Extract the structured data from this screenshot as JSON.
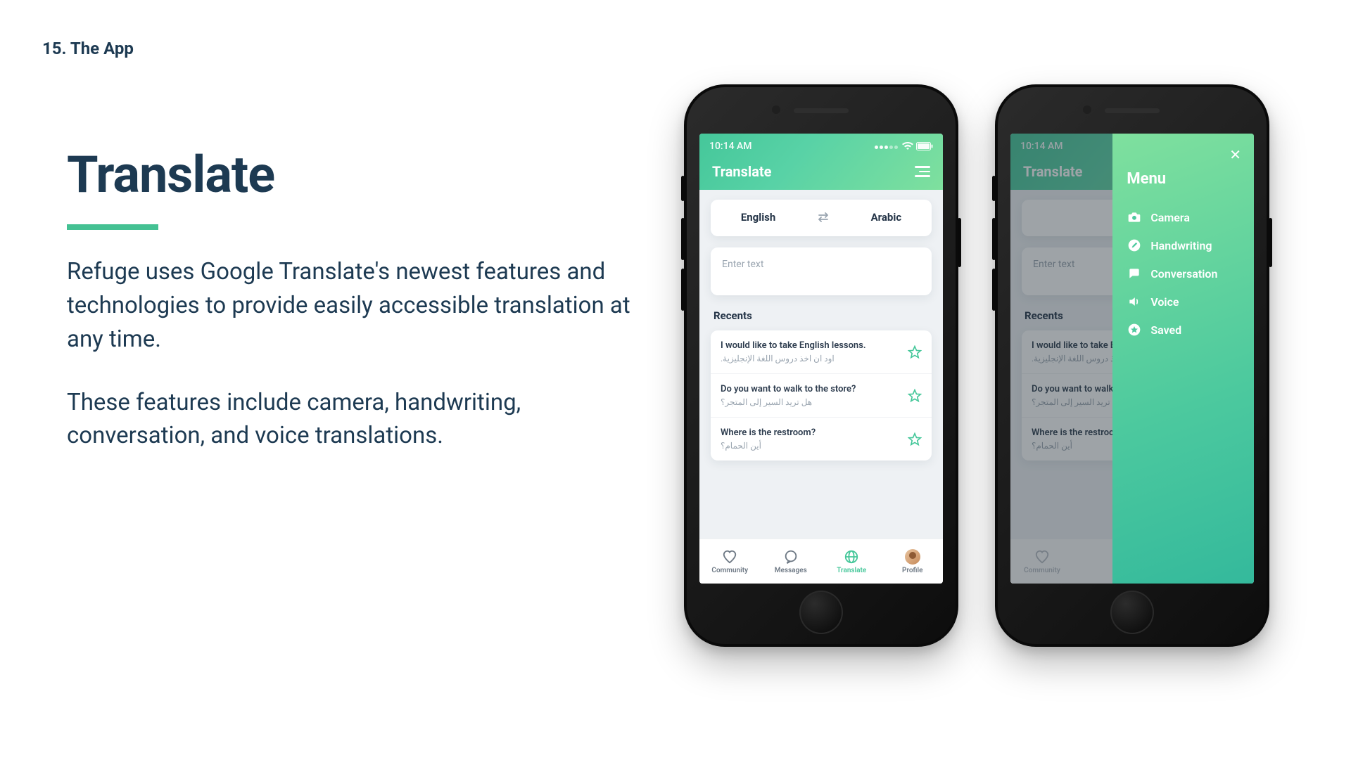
{
  "page_label": "15. The App",
  "title": "Translate",
  "paragraphs": [
    "Refuge uses Google Translate's newest features and technologies to provide easily accessible translation at any time.",
    "These features include camera, handwriting, conversation, and voice translations."
  ],
  "status_time": "10:14 AM",
  "screen_title": "Translate",
  "lang_from": "English",
  "lang_to": "Arabic",
  "enter_placeholder": "Enter text",
  "recents_label": "Recents",
  "recents": [
    {
      "en": "I would like to take English lessons.",
      "ar": "اود ان اخذ دروس اللغة الإنجليزية."
    },
    {
      "en": "Do you want to walk to the store?",
      "ar": "هل تريد السير إلى المتجر؟"
    },
    {
      "en": "Where is the restroom?",
      "ar": "أين الحمام؟"
    }
  ],
  "tabs": [
    {
      "label": "Community"
    },
    {
      "label": "Messages"
    },
    {
      "label": "Translate"
    },
    {
      "label": "Profile"
    }
  ],
  "menu_title": "Menu",
  "menu_items": [
    {
      "icon": "camera-icon",
      "label": "Camera"
    },
    {
      "icon": "pencil-icon",
      "label": "Handwriting"
    },
    {
      "icon": "chat-icon",
      "label": "Conversation"
    },
    {
      "icon": "speaker-icon",
      "label": "Voice"
    },
    {
      "icon": "star-icon",
      "label": "Saved"
    }
  ]
}
